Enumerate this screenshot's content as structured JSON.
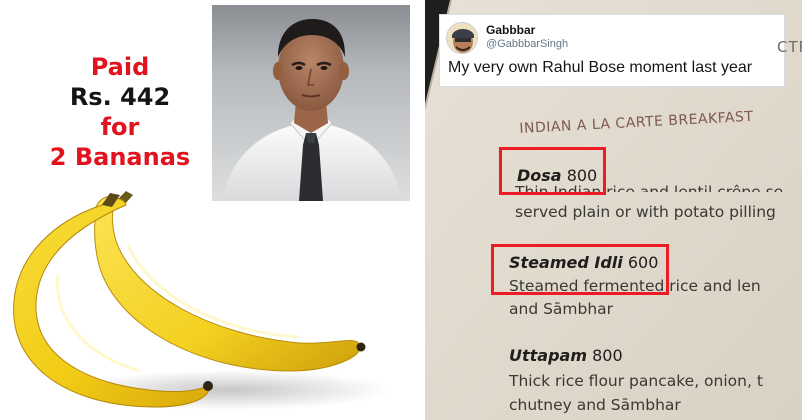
{
  "left_panel": {
    "caption": {
      "line1": "Paid",
      "line2": "Rs. 442",
      "line3": "for",
      "line4": "2 Bananas"
    },
    "colors": {
      "red": "#e0141e",
      "dark": "#151515",
      "banana": "#f3d21e"
    }
  },
  "tweet": {
    "name": "Gabbbar",
    "handle": "@GabbbarSingh",
    "text": "My very own Rahul Bose moment last year"
  },
  "menu": {
    "corner_text": "CTR",
    "section_title": "INDIAN A LA CARTE BREAKFAST",
    "items": [
      {
        "name": "Dosa",
        "price": "800",
        "desc1": "Thin Indian rice and lentil crêpe se",
        "desc2": "served plain or with potato pilling"
      },
      {
        "name": "Steamed Idli",
        "price": "600",
        "desc1": "Steamed fermented rice and len",
        "desc2": "and Sāmbhar"
      },
      {
        "name": "Uttapam",
        "price": "800",
        "desc1": "Thick rice flour pancake, onion, t",
        "desc2": "chutney and Sāmbhar"
      }
    ],
    "highlight_color": "#ed1b24"
  }
}
